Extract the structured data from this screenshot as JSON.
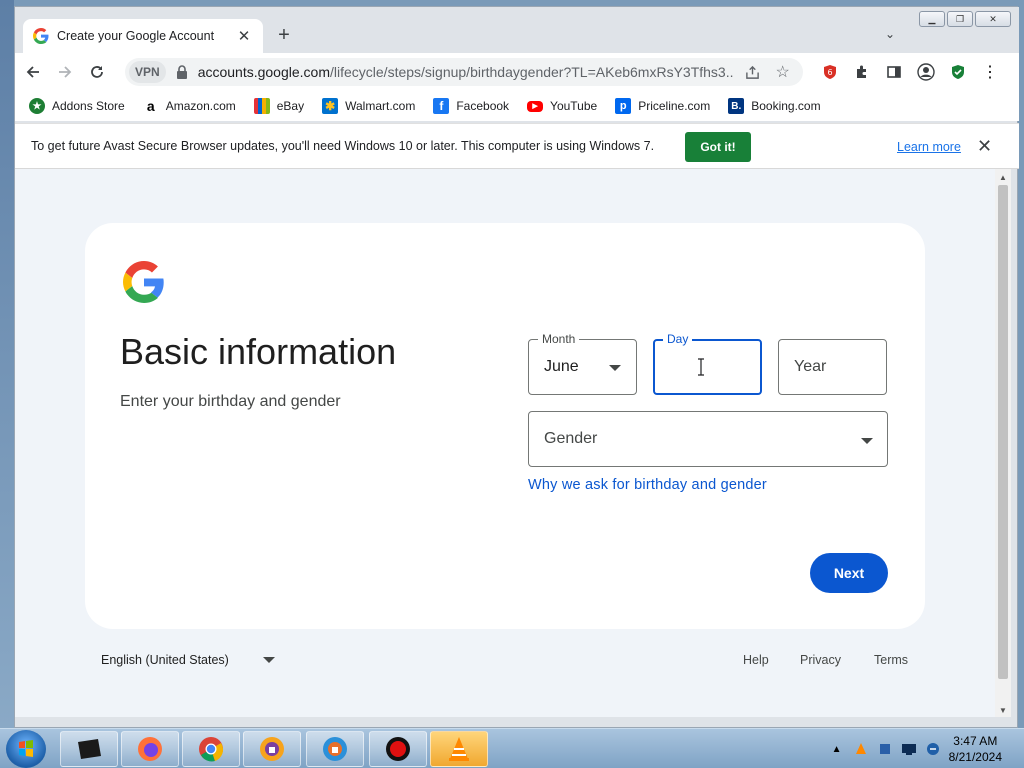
{
  "tab": {
    "title": "Create your Google Account"
  },
  "toolbar": {
    "vpn_label": "VPN",
    "url_host": "accounts.google.com",
    "url_path": "/lifecycle/steps/signup/birthdaygender?TL=AKeb6mxRsY3Tfhs3..."
  },
  "bookmarks": [
    {
      "label": "Addons Store",
      "icon": "addons-store-icon",
      "color": "#1e7e34"
    },
    {
      "label": "Amazon.com",
      "icon": "amazon-icon",
      "color": "#000000"
    },
    {
      "label": "eBay",
      "icon": "ebay-icon",
      "color": "#e53238"
    },
    {
      "label": "Walmart.com",
      "icon": "walmart-icon",
      "color": "#0071ce"
    },
    {
      "label": "Facebook",
      "icon": "facebook-icon",
      "color": "#1877f2"
    },
    {
      "label": "YouTube",
      "icon": "youtube-icon",
      "color": "#ff0000"
    },
    {
      "label": "Priceline.com",
      "icon": "priceline-icon",
      "color": "#0068ef"
    },
    {
      "label": "Booking.com",
      "icon": "booking-icon",
      "color": "#003580"
    }
  ],
  "infobar": {
    "message": "To get future Avast Secure Browser updates, you'll need Windows 10 or later. This computer is using Windows 7.",
    "got_it": "Got it!",
    "learn_more": "Learn more"
  },
  "form": {
    "heading": "Basic information",
    "subheading": "Enter your birthday and gender",
    "month": {
      "label": "Month",
      "value": "June"
    },
    "day": {
      "label": "Day",
      "value": ""
    },
    "year": {
      "placeholder": "Year"
    },
    "gender": {
      "placeholder": "Gender"
    },
    "why_link": "Why we ask for birthday and gender",
    "next": "Next"
  },
  "footer": {
    "language": "English (United States)",
    "help": "Help",
    "privacy": "Privacy",
    "terms": "Terms"
  },
  "taskbar": {
    "time": "3:47 AM",
    "date": "8/21/2024"
  },
  "colors": {
    "accent": "#0b57d0",
    "got_it": "#188038"
  }
}
